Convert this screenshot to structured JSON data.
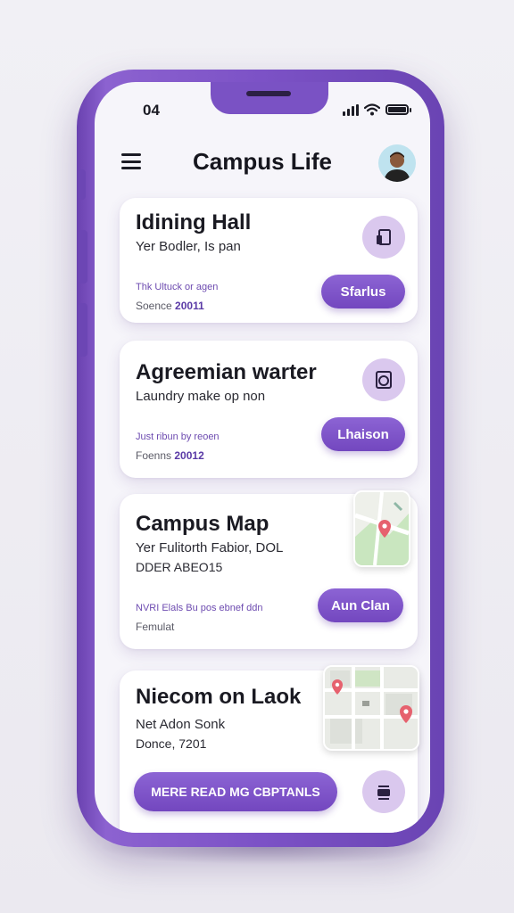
{
  "status": {
    "time": "04"
  },
  "header": {
    "title": "Campus Life"
  },
  "cards": [
    {
      "title": "Idining Hall",
      "subtitle": "Yer Bodler, Is pan",
      "meta": "Thk Ultuck or agen",
      "meta2_label": "Soence",
      "meta2_value": "20011",
      "button": "Sfarlus",
      "icon": "dining-icon"
    },
    {
      "title": "Agreemian warter",
      "subtitle": "Laundry make op non",
      "meta": "Just ribun by reoen",
      "meta2_label": "Foenns",
      "meta2_value": "20012",
      "button": "Lhaison",
      "icon": "laundry-icon"
    },
    {
      "title": "Campus Map",
      "subtitle": "Yer Fulitorth Fabior, DOL",
      "subtitle2": "DDER ABEO15",
      "meta": "NVRI Elals Bu pos ebnef ddn",
      "meta2_label": "Femulat",
      "button": "Aun Clan",
      "icon": "map-thumbnail"
    },
    {
      "title": "Niecom on Laok",
      "subtitle": "Net Adon Sonk",
      "subtitle2": "Donce, 7201",
      "button": "MERE READ MG CBPTANLS",
      "icon": "map-thumbnail"
    }
  ],
  "colors": {
    "accent": "#7a4fc5",
    "accent_light": "#dac8ee",
    "background": "#f6f5fa"
  }
}
